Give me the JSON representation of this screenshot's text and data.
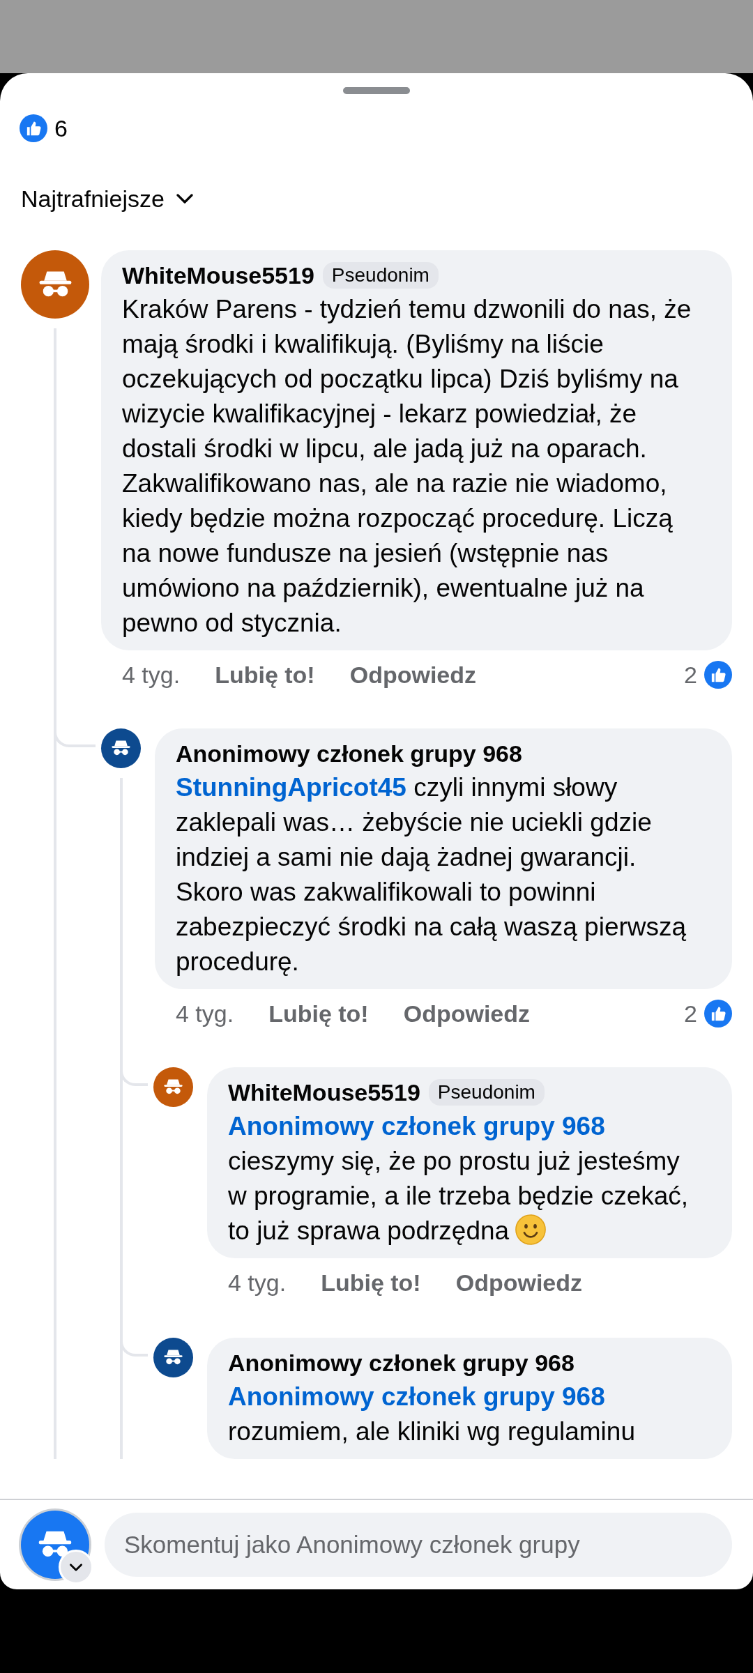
{
  "reactions": {
    "count": "6"
  },
  "sort": {
    "label": "Najtrafniejsze"
  },
  "comments": [
    {
      "author": "WhiteMouse5519",
      "badge": "Pseudonim",
      "color": "#c4590a",
      "text": "Kraków Parens - tydzień temu dzwonili do nas, że mają środki i kwalifikują. (Byliśmy na liście oczekujących od początku lipca) Dziś byliśmy na wizycie kwalifikacyjnej - lekarz powiedział, że dostali środki w lipcu, ale jadą już na oparach. Zakwalifikowano nas, ale na razie nie wiadomo, kiedy będzie można rozpocząć procedurę. Liczą na nowe fundusze na jesień (wstępnie nas umówiono na październik), ewentualne już na pewno od stycznia.",
      "time": "4 tyg.",
      "like_label": "Lubię to!",
      "reply_label": "Odpowiedz",
      "likes": "2",
      "replies": [
        {
          "author": "Anonimowy członek grupy 968",
          "color": "#0d4a8f",
          "mention": "StunningApricot45",
          "text": "czyli innymi słowy zaklepali was… żebyście nie uciekli gdzie indziej a sami nie dają żadnej gwarancji. Skoro was zakwalifikowali to powinni zabezpieczyć środki na całą waszą pierwszą procedurę.",
          "time": "4 tyg.",
          "like_label": "Lubię to!",
          "reply_label": "Odpowiedz",
          "likes": "2",
          "replies": [
            {
              "author": "WhiteMouse5519",
              "badge": "Pseudonim",
              "color": "#c4590a",
              "mention": "Anonimowy członek grupy 968",
              "text": "cieszymy się, że po prostu już jesteśmy w programie, a ile trzeba będzie czekać, to już sprawa podrzędna",
              "smiley": true,
              "time": "4 tyg.",
              "like_label": "Lubię to!",
              "reply_label": "Odpowiedz"
            },
            {
              "author": "Anonimowy członek grupy 968",
              "color": "#0d4a8f",
              "mention": "Anonimowy członek grupy 968",
              "text": "rozumiem, ale kliniki wg regulaminu"
            }
          ]
        }
      ]
    }
  ],
  "composer": {
    "placeholder": "Skomentuj jako Anonimowy członek grupy"
  }
}
